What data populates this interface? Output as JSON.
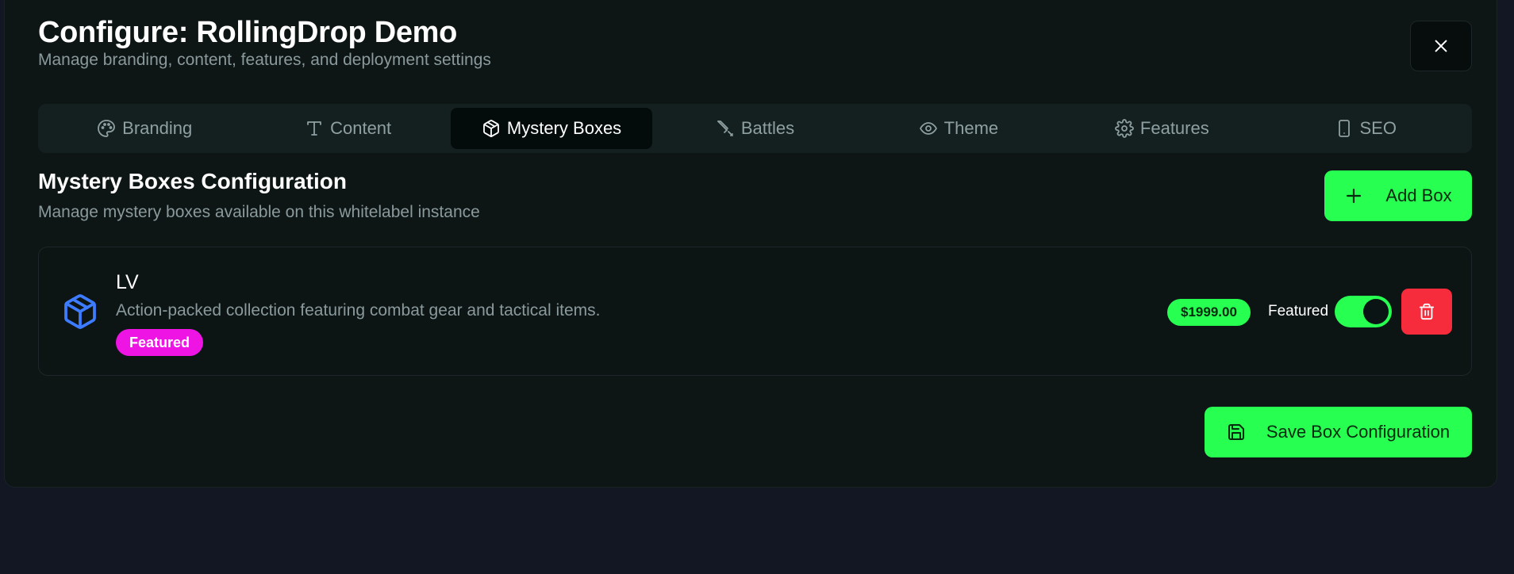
{
  "header": {
    "title": "Configure: RollingDrop Demo",
    "subtitle": "Manage branding, content, features, and deployment settings",
    "close_icon": "close-icon"
  },
  "tabs": [
    {
      "label": "Branding",
      "icon": "palette-icon",
      "active": false
    },
    {
      "label": "Content",
      "icon": "type-icon",
      "active": false
    },
    {
      "label": "Mystery Boxes",
      "icon": "package-icon",
      "active": true
    },
    {
      "label": "Battles",
      "icon": "sword-icon",
      "active": false
    },
    {
      "label": "Theme",
      "icon": "eye-icon",
      "active": false
    },
    {
      "label": "Features",
      "icon": "gear-icon",
      "active": false
    },
    {
      "label": "SEO",
      "icon": "smartphone-icon",
      "active": false
    }
  ],
  "section": {
    "title": "Mystery Boxes Configuration",
    "subtitle": "Manage mystery boxes available on this whitelabel instance",
    "add_label": "Add Box"
  },
  "boxes": [
    {
      "name": "LV",
      "description": "Action-packed collection featuring combat gear and tactical items.",
      "badge": "Featured",
      "price": "$1999.00",
      "featured_label": "Featured",
      "featured": true
    }
  ],
  "footer": {
    "save_label": "Save Box Configuration"
  },
  "colors": {
    "accent": "#27ff51",
    "danger": "#f62b3c",
    "badge": "#ee14e4",
    "box_icon": "#3d7bff"
  }
}
